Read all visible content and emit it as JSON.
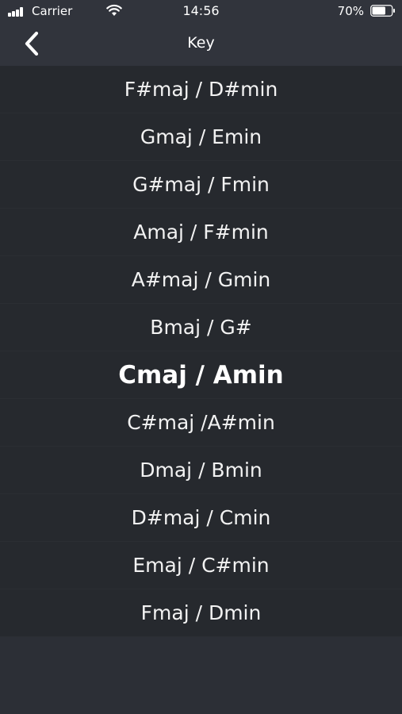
{
  "status_bar": {
    "carrier": "Carrier",
    "time": "14:56",
    "battery_percent": "70%",
    "battery_level": 0.7,
    "signal_icon": "cellular-signal-icon",
    "wifi_icon": "wifi-icon",
    "battery_icon": "battery-icon"
  },
  "nav": {
    "title": "Key",
    "back_icon": "chevron-left-icon"
  },
  "keys": {
    "items": [
      "F#maj / D#min",
      "Gmaj / Emin",
      "G#maj / Fmin",
      "Amaj / F#min",
      "A#maj / Gmin",
      "Bmaj / G#",
      "Cmaj / Amin",
      "C#maj /A#min",
      "Dmaj / Bmin",
      "D#maj / Cmin",
      "Emaj / C#min",
      "Fmaj / Dmin"
    ],
    "selected": "Cmaj / Amin"
  },
  "colors": {
    "background": "#2c2f36",
    "bar": "#31343c",
    "list": "#26292e",
    "text": "#ffffff"
  }
}
